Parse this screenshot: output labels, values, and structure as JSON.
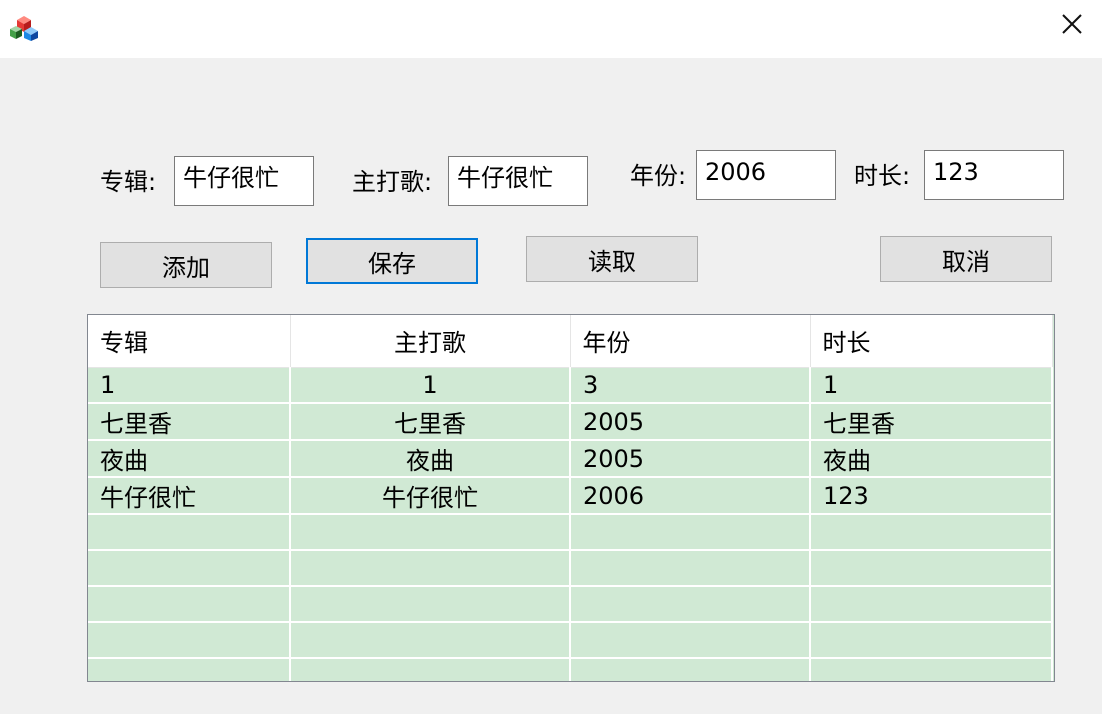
{
  "window": {
    "close_glyph": "✕"
  },
  "form": {
    "album_label": "专辑:",
    "album_value": "牛仔很忙",
    "hit_label": "主打歌:",
    "hit_value": "牛仔很忙",
    "year_label": "年份:",
    "year_value": "2006",
    "duration_label": "时长:",
    "duration_value": "123"
  },
  "buttons": {
    "add": "添加",
    "save": "保存",
    "read": "读取",
    "cancel": "取消"
  },
  "grid": {
    "columns": [
      "专辑",
      "主打歌",
      "年份",
      "时长"
    ],
    "rows": [
      [
        "1",
        "1",
        "3",
        "1"
      ],
      [
        "七里香",
        "七里香",
        "2005",
        "七里香"
      ],
      [
        "夜曲",
        "夜曲",
        "2005",
        "夜曲"
      ],
      [
        "牛仔很忙",
        "牛仔很忙",
        "2006",
        "123"
      ],
      [
        "",
        "",
        "",
        ""
      ],
      [
        "",
        "",
        "",
        ""
      ],
      [
        "",
        "",
        "",
        ""
      ],
      [
        "",
        "",
        "",
        ""
      ],
      [
        "",
        "",
        "",
        ""
      ]
    ]
  },
  "icons": {
    "app": "app-blocks-icon",
    "close": "close-icon"
  }
}
